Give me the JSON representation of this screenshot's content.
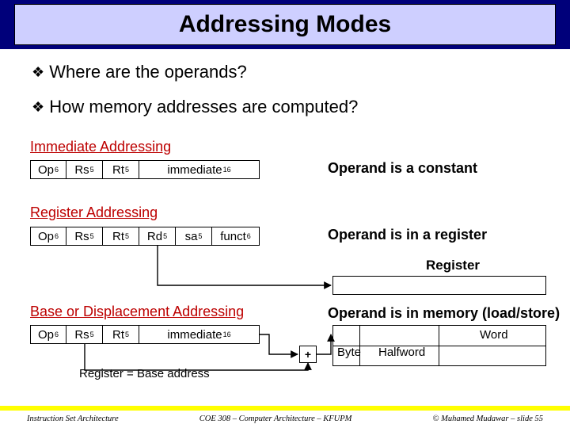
{
  "title": "Addressing Modes",
  "bullets": {
    "q1": "Where are the operands?",
    "q2": "How memory addresses are computed?"
  },
  "glyphs": {
    "diamond": "❖"
  },
  "sections": {
    "imm": "Immediate Addressing",
    "reg": "Register Addressing",
    "base": "Base or Displacement Addressing"
  },
  "fields": {
    "op": {
      "name": "Op",
      "sup": "6"
    },
    "rs": {
      "name": "Rs",
      "sup": "5"
    },
    "rt": {
      "name": "Rt",
      "sup": "5"
    },
    "rd": {
      "name": "Rd",
      "sup": "5"
    },
    "sa": {
      "name": "sa",
      "sup": "5"
    },
    "funct": {
      "name": "funct",
      "sup": "6"
    },
    "imm": {
      "name": "immediate",
      "sup": "16"
    }
  },
  "descriptions": {
    "imm": "Operand is a constant",
    "reg": "Operand is in a register",
    "base": "Operand is in memory (load/store)"
  },
  "register_box_title": "Register",
  "memory": {
    "byte": "Byte",
    "halfword": "Halfword",
    "word": "Word"
  },
  "plus": "+",
  "base_note": "Register = Base address",
  "footer": {
    "left": "Instruction Set Architecture",
    "center": "COE 308 – Computer Architecture – KFUPM",
    "right": "© Muhamed Mudawar – slide 55"
  }
}
